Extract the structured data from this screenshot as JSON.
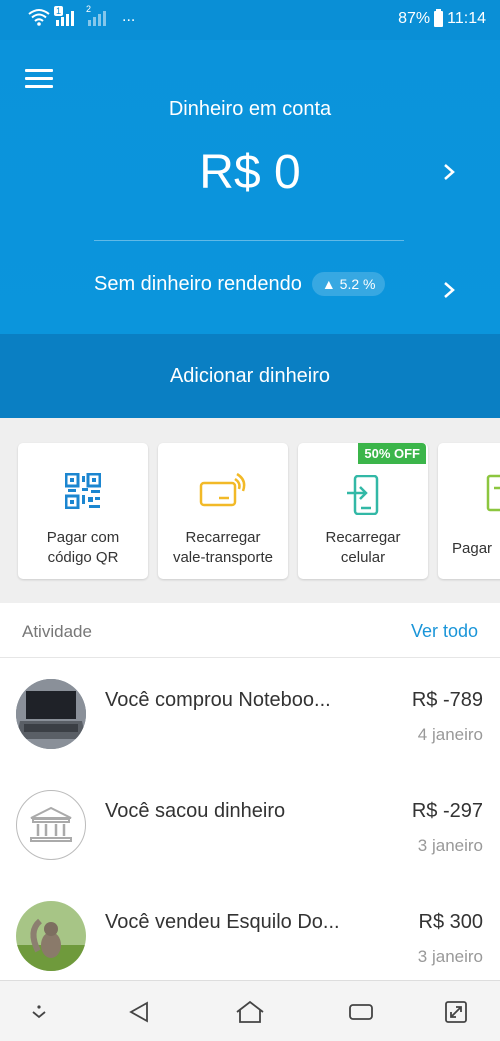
{
  "status_bar": {
    "signal_1": "1",
    "signal_2": "2",
    "more": "...",
    "battery": "87%",
    "time": "11:14"
  },
  "header": {
    "balance_label": "Dinheiro em conta",
    "balance_value": "R$ 0",
    "savings_label": "Sem dinheiro rendendo",
    "savings_rate": "▲ 5.2 %",
    "add_money": "Adicionar dinheiro"
  },
  "shortcuts": [
    {
      "label_line1": "Pagar com",
      "label_line2": "código QR",
      "icon": "qr-code-icon"
    },
    {
      "label_line1": "Recarregar",
      "label_line2": "vale-transporte",
      "icon": "transit-card-icon"
    },
    {
      "label_line1": "Recarregar",
      "label_line2": "celular",
      "icon": "phone-recharge-icon",
      "badge": "50% OFF"
    },
    {
      "label_line1": "Pagar",
      "label_line2": "",
      "icon": "bill-icon"
    }
  ],
  "activity": {
    "title": "Atividade",
    "see_all": "Ver todo",
    "items": [
      {
        "title": "Você comprou Noteboo...",
        "amount": "R$ -789",
        "date": "4 janeiro",
        "avatar": "laptop-photo"
      },
      {
        "title": "Você sacou dinheiro",
        "amount": "R$ -297",
        "date": "3 janeiro",
        "avatar": "bank-icon"
      },
      {
        "title": "Você vendeu Esquilo Do...",
        "amount": "R$ 300",
        "date": "3 janeiro",
        "avatar": "squirrel-photo"
      }
    ]
  },
  "colors": {
    "primary": "#0b93db",
    "primary_dark": "#0a7fc3",
    "accent_link": "#1a95d8",
    "badge_green": "#3bb54a",
    "icon_yellow": "#f2b927",
    "icon_teal": "#32b8a6"
  }
}
